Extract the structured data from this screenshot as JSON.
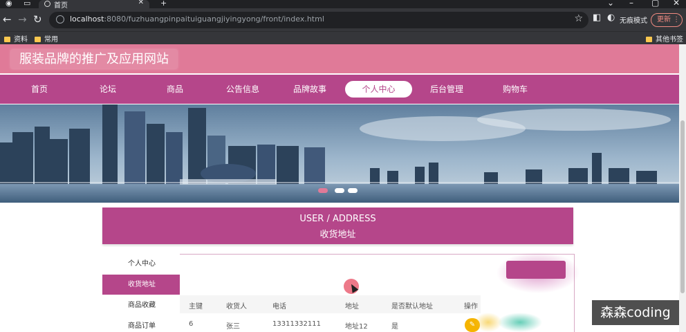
{
  "browser": {
    "tab_title": "首页",
    "url_host": "localhost",
    "url_rest": ":8080/fuzhuangpinpaituiguangjiyingyong/front/index.html",
    "incognito_label": "无痕模式",
    "update_label": "更新",
    "bookmarks": [
      "资料",
      "常用"
    ],
    "other_bookmarks": "其他书签"
  },
  "site": {
    "title": "服装品牌的推广及应用网站",
    "nav": [
      "首页",
      "论坛",
      "商品",
      "公告信息",
      "品牌故事",
      "个人中心",
      "后台管理",
      "购物车"
    ],
    "active_nav": "个人中心"
  },
  "section": {
    "title_en": "USER / ADDRESS",
    "title_cn": "收货地址"
  },
  "sidebar": {
    "items": [
      "个人中心",
      "收货地址",
      "商品收藏",
      "商品订单"
    ],
    "active": "收货地址"
  },
  "table": {
    "headers": [
      "主键",
      "收货人",
      "电话",
      "地址",
      "是否默认地址",
      "操作"
    ],
    "rows": [
      [
        "6",
        "张三",
        "13311332111",
        "地址12",
        "是"
      ]
    ]
  },
  "watermark": "森森coding",
  "colors": {
    "header_pink": "#e07a98",
    "nav_magenta": "#b5468a",
    "edit_yellow": "#f5b400",
    "browser_dark": "#35363a"
  },
  "icons": [
    "browser-tab-icon",
    "back-arrow-icon",
    "forward-arrow-icon",
    "reload-icon",
    "lock-icon",
    "star-icon",
    "sidebar-icon",
    "incognito-icon",
    "folder-icon",
    "edit-pencil-icon"
  ]
}
